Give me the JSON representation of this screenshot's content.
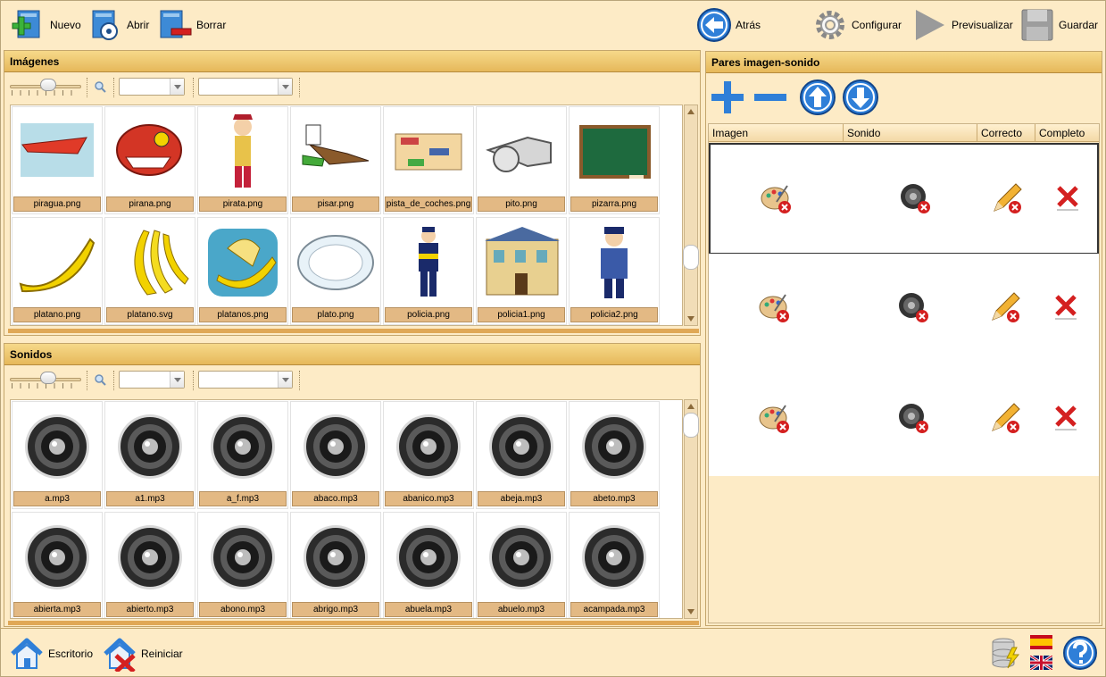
{
  "toolbar": {
    "new_label": "Nuevo",
    "open_label": "Abrir",
    "delete_label": "Borrar",
    "back_label": "Atrás",
    "configure_label": "Configurar",
    "preview_label": "Previsualizar",
    "save_label": "Guardar"
  },
  "images_panel": {
    "title": "Imágenes",
    "files": [
      "piragua.png",
      "pirana.png",
      "pirata.png",
      "pisar.png",
      "pista_de_coches.png",
      "pito.png",
      "pizarra.png",
      "platano.png",
      "platano.svg",
      "platanos.png",
      "plato.png",
      "policia.png",
      "policia1.png",
      "policia2.png"
    ]
  },
  "sounds_panel": {
    "title": "Sonidos",
    "files": [
      "a.mp3",
      "a1.mp3",
      "a_f.mp3",
      "abaco.mp3",
      "abanico.mp3",
      "abeja.mp3",
      "abeto.mp3",
      "abierta.mp3",
      "abierto.mp3",
      "abono.mp3",
      "abrigo.mp3",
      "abuela.mp3",
      "abuelo.mp3",
      "acampada.mp3"
    ]
  },
  "pairs_panel": {
    "title": "Pares imagen-sonido",
    "columns": [
      "Imagen",
      "Sonido",
      "Correcto",
      "Completo"
    ],
    "rows": 3
  },
  "statusbar": {
    "desktop_label": "Escritorio",
    "restart_label": "Reiniciar"
  },
  "colors": {
    "background": "#fdebc6",
    "header": "#e6b85a",
    "caption": "#e3b984",
    "accent_blue": "#2f7fd8",
    "error_red": "#d42020"
  }
}
